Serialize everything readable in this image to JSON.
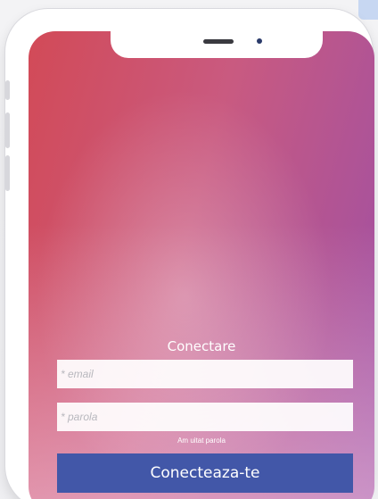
{
  "login": {
    "title": "Conectare",
    "email_placeholder": "* email",
    "password_placeholder": "* parola",
    "forgot_link": "Am uitat parola",
    "submit_label": "Conecteaza-te"
  }
}
